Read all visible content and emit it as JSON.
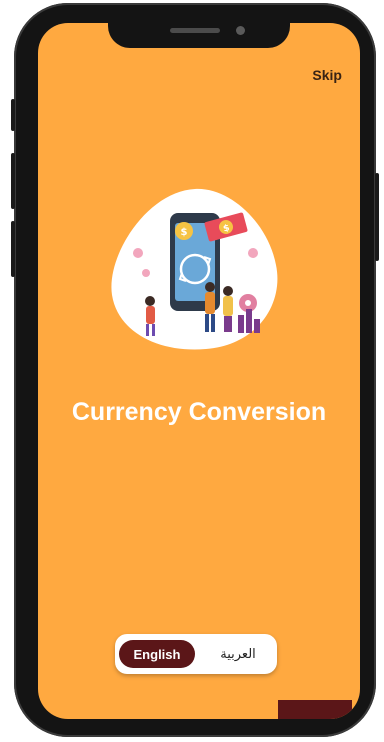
{
  "onboarding": {
    "skip_label": "Skip",
    "title": "Currency Conversion",
    "illustration_icon": "currency-exchange-illustration"
  },
  "language_toggle": {
    "selected": "English",
    "options": [
      "English",
      "العربية"
    ]
  },
  "colors": {
    "background": "#FFA940",
    "accent": "#5B1618",
    "title_text": "#FFFFFF",
    "phone_frame": "#141414"
  }
}
